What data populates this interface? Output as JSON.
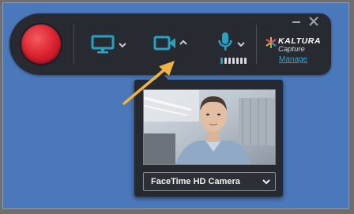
{
  "toolbar": {
    "record_button_label": "Record",
    "screen_icon": "monitor-icon",
    "camera_icon": "video-camera-icon",
    "mic_icon": "microphone-icon",
    "mic_level": 0.2,
    "accent_color": "#27a0c4",
    "record_color": "#d81e2c"
  },
  "brand": {
    "name": "KALTURA",
    "sub": "Capture",
    "manage_label": "Manage"
  },
  "camera_popup": {
    "selected_camera": "FaceTime HD Camera"
  }
}
